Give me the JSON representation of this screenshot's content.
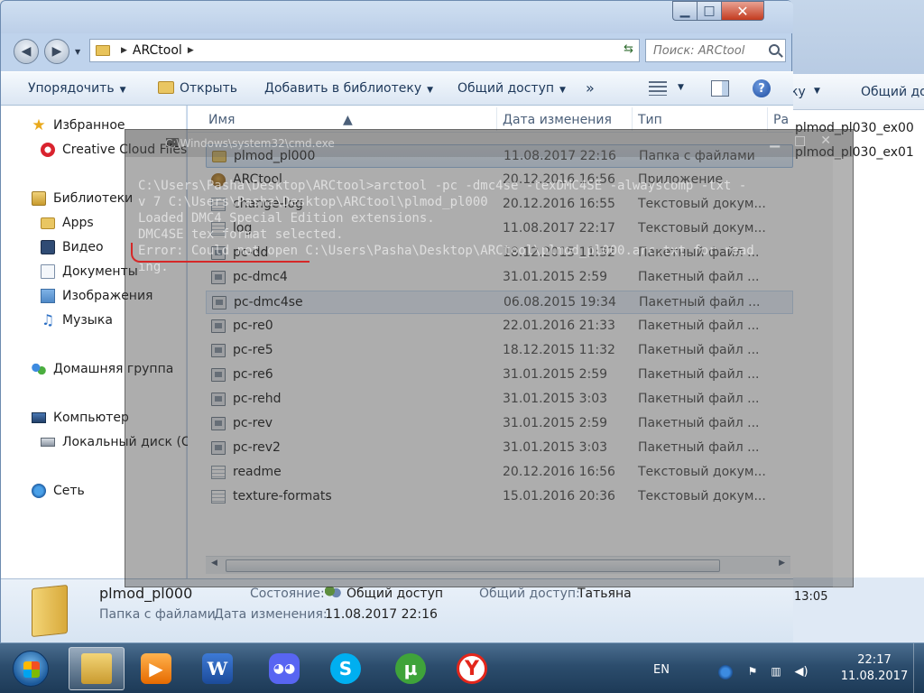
{
  "background_window": {
    "toolbar": {
      "organize_label": "ку",
      "share_label": "Общий до"
    },
    "files": [
      "plmod_pl030_ex00",
      "plmod_pl030_ex01"
    ],
    "time": "13:05"
  },
  "explorer": {
    "address": {
      "crumb": "ARCtool"
    },
    "search": {
      "placeholder": "Поиск: ARCtool"
    },
    "toolbar": {
      "organize": "Упорядочить",
      "open": "Открыть",
      "add_to_library": "Добавить в библиотеку",
      "share": "Общий доступ",
      "more": "»"
    },
    "nav": {
      "favorites": "Избранное",
      "creative_cloud": "Creative Cloud Files",
      "libraries": "Библиотеки",
      "apps": "Apps",
      "video": "Видео",
      "documents": "Документы",
      "images": "Изображения",
      "music": "Музыка",
      "homegroup": "Домашняя группа",
      "computer": "Компьютер",
      "local_disk": "Локальный диск (C:)",
      "network": "Сеть"
    },
    "columns": {
      "name": "Имя",
      "date": "Дата изменения",
      "type": "Тип",
      "size": "Ра"
    },
    "files": [
      {
        "name": "plmod_pl000",
        "date": "11.08.2017 22:16",
        "type": "Папка с файлами",
        "icon": "folder-icon"
      },
      {
        "name": "ARCtool",
        "date": "20.12.2016 16:56",
        "type": "Приложение",
        "icon": "app-icon"
      },
      {
        "name": "change-log",
        "date": "20.12.2016 16:55",
        "type": "Текстовый докум...",
        "icon": "text-file-icon"
      },
      {
        "name": "log",
        "date": "11.08.2017 22:17",
        "type": "Текстовый докум...",
        "icon": "text-file-icon"
      },
      {
        "name": "pc-dd",
        "date": "18.12.2015 11:32",
        "type": "Пакетный файл ...",
        "icon": "batch-file-icon"
      },
      {
        "name": "pc-dmc4",
        "date": "31.01.2015 2:59",
        "type": "Пакетный файл ...",
        "icon": "batch-file-icon"
      },
      {
        "name": "pc-dmc4se",
        "date": "06.08.2015 19:34",
        "type": "Пакетный файл ...",
        "icon": "batch-file-icon"
      },
      {
        "name": "pc-re0",
        "date": "22.01.2016 21:33",
        "type": "Пакетный файл ...",
        "icon": "batch-file-icon"
      },
      {
        "name": "pc-re5",
        "date": "18.12.2015 11:32",
        "type": "Пакетный файл ...",
        "icon": "batch-file-icon"
      },
      {
        "name": "pc-re6",
        "date": "31.01.2015 2:59",
        "type": "Пакетный файл ...",
        "icon": "batch-file-icon"
      },
      {
        "name": "pc-rehd",
        "date": "31.01.2015 3:03",
        "type": "Пакетный файл ...",
        "icon": "batch-file-icon"
      },
      {
        "name": "pc-rev",
        "date": "31.01.2015 2:59",
        "type": "Пакетный файл ...",
        "icon": "batch-file-icon"
      },
      {
        "name": "pc-rev2",
        "date": "31.01.2015 3:03",
        "type": "Пакетный файл ...",
        "icon": "batch-file-icon"
      },
      {
        "name": "readme",
        "date": "20.12.2016 16:56",
        "type": "Текстовый докум...",
        "icon": "text-file-icon"
      },
      {
        "name": "texture-formats",
        "date": "15.01.2016 20:36",
        "type": "Текстовый докум...",
        "icon": "text-file-icon"
      }
    ],
    "details": {
      "name": "plmod_pl000",
      "kind": "Папка с файлами",
      "state_label": "Состояние:",
      "state_value": "Общий доступ",
      "share_label": "Общий доступ:",
      "share_value": "Татьяна",
      "modified_label": "Дата изменения:",
      "modified_value": "11.08.2017 22:16"
    }
  },
  "cmd": {
    "title": "C:\\Windows\\system32\\cmd.exe",
    "lines": [
      "C:\\Users\\Pasha\\Desktop\\ARCtool>arctool -pc -dmc4se -texDMC4SE -alwayscomp -txt -",
      "v 7 C:\\Users\\Pasha\\Desktop\\ARCtool\\plmod_pl000",
      "Loaded DMC4 Special Edition extensions.",
      "DMC4SE tex format selected.",
      "Error: Could not open C:\\Users\\Pasha\\Desktop\\ARCtool\\plmod_pl000.arc.txt for read",
      "ing."
    ]
  },
  "taskbar": {
    "lang": "EN",
    "time": "22:17",
    "date": "11.08.2017",
    "apps": [
      "explorer",
      "media-player",
      "word",
      "discord",
      "skype",
      "utorrent",
      "yandex-browser"
    ]
  }
}
